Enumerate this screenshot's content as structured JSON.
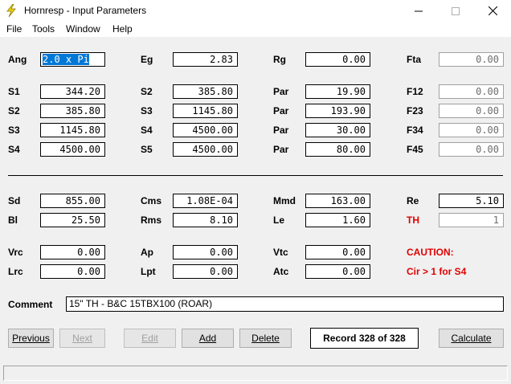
{
  "window": {
    "title": "Hornresp - Input Parameters"
  },
  "menu": [
    "File",
    "Tools",
    "Window",
    "Help"
  ],
  "params": {
    "Ang": {
      "label": "Ang",
      "value": "2.0 x Pi"
    },
    "Eg": {
      "label": "Eg",
      "value": "2.83"
    },
    "Rg": {
      "label": "Rg",
      "value": "0.00"
    },
    "Fta": {
      "label": "Fta",
      "value": "0.00"
    },
    "S1": {
      "label": "S1",
      "value": "344.20"
    },
    "S2a": {
      "label": "S2",
      "value": "385.80"
    },
    "Par1": {
      "label": "Par",
      "value": "19.90"
    },
    "F12": {
      "label": "F12",
      "value": "0.00"
    },
    "S2b": {
      "label": "S2",
      "value": "385.80"
    },
    "S3a": {
      "label": "S3",
      "value": "1145.80"
    },
    "Par2": {
      "label": "Par",
      "value": "193.90"
    },
    "F23": {
      "label": "F23",
      "value": "0.00"
    },
    "S3b": {
      "label": "S3",
      "value": "1145.80"
    },
    "S4a": {
      "label": "S4",
      "value": "4500.00"
    },
    "Par3": {
      "label": "Par",
      "value": "30.00"
    },
    "F34": {
      "label": "F34",
      "value": "0.00"
    },
    "S4b": {
      "label": "S4",
      "value": "4500.00"
    },
    "S5": {
      "label": "S5",
      "value": "4500.00"
    },
    "Par4": {
      "label": "Par",
      "value": "80.00"
    },
    "F45": {
      "label": "F45",
      "value": "0.00"
    },
    "Sd": {
      "label": "Sd",
      "value": "855.00"
    },
    "Cms": {
      "label": "Cms",
      "value": "1.08E-04"
    },
    "Mmd": {
      "label": "Mmd",
      "value": "163.00"
    },
    "Re": {
      "label": "Re",
      "value": "5.10"
    },
    "Bl": {
      "label": "Bl",
      "value": "25.50"
    },
    "Rms": {
      "label": "Rms",
      "value": "8.10"
    },
    "Le": {
      "label": "Le",
      "value": "1.60"
    },
    "TH": {
      "label": "TH",
      "value": "1"
    },
    "Vrc": {
      "label": "Vrc",
      "value": "0.00"
    },
    "Ap": {
      "label": "Ap",
      "value": "0.00"
    },
    "Vtc": {
      "label": "Vtc",
      "value": "0.00"
    },
    "Lrc": {
      "label": "Lrc",
      "value": "0.00"
    },
    "Lpt": {
      "label": "Lpt",
      "value": "0.00"
    },
    "Atc": {
      "label": "Atc",
      "value": "0.00"
    }
  },
  "warnings": {
    "caution": "CAUTION:",
    "message": "Cir > 1 for S4"
  },
  "comment": {
    "label": "Comment",
    "value": "15\" TH - B&C 15TBX100 (ROAR)"
  },
  "buttons": {
    "previous": "Previous",
    "next": "Next",
    "edit": "Edit",
    "add": "Add",
    "delete": "Delete",
    "calculate": "Calculate"
  },
  "record": "Record 328 of 328",
  "colors": {
    "warning": "#e00000",
    "selection": "#0078d7"
  }
}
